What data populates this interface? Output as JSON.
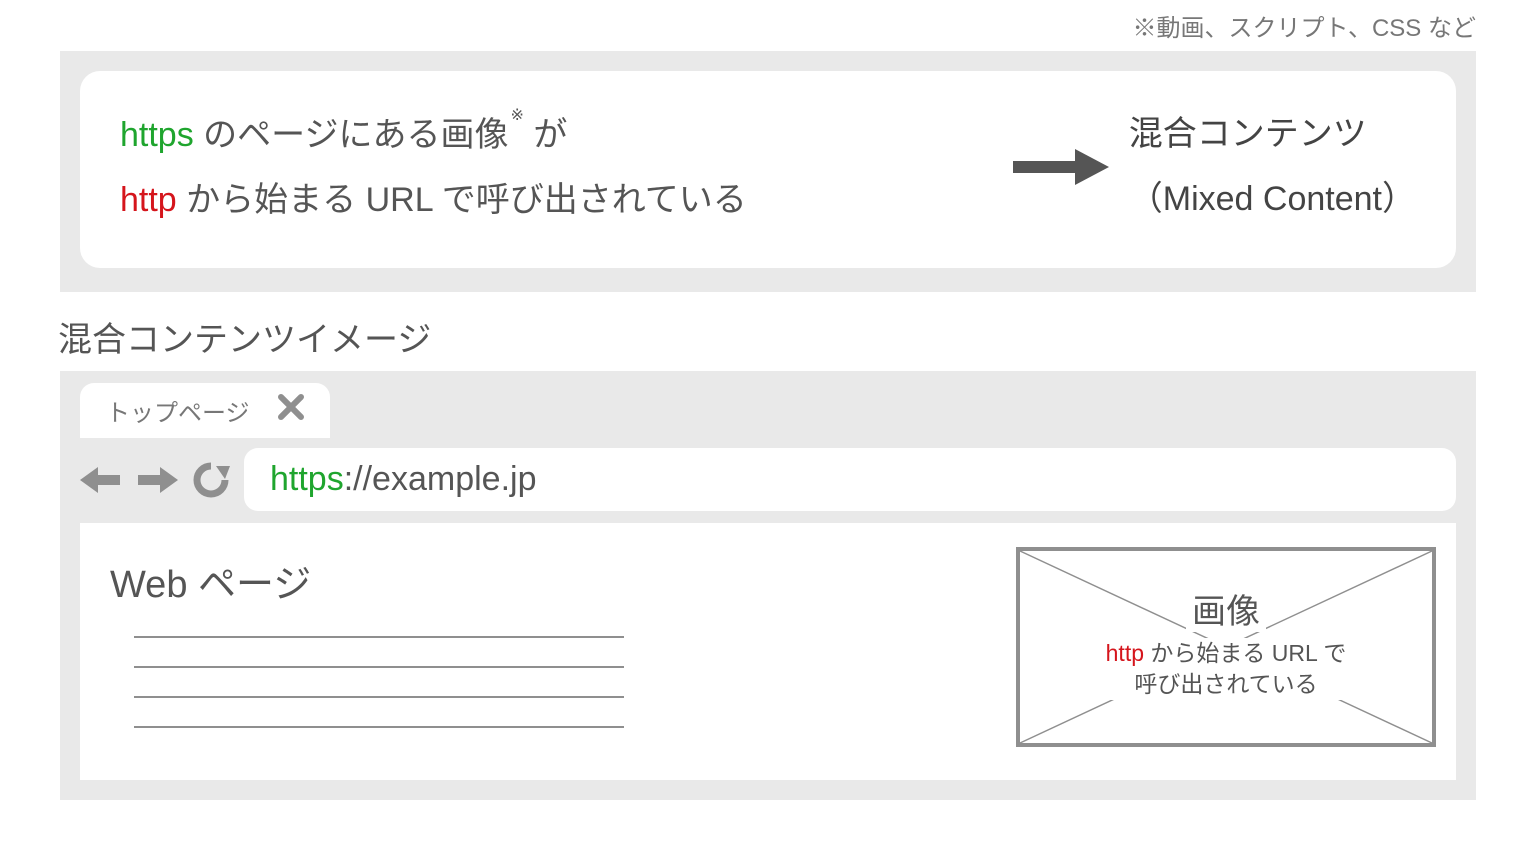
{
  "top_note": "※動画、スクリプト、CSS など",
  "card": {
    "https": "https",
    "line1_rest": " のページにある画像",
    "asterisk": "※",
    "line1_tail": " が",
    "http": "http",
    "line2_rest": " から始まる URL で呼び出されている",
    "result_line1": "混合コンテンツ",
    "result_line2": "（Mixed Content）"
  },
  "section_title": "混合コンテンツイメージ",
  "browser": {
    "tab_label": "トップページ",
    "url_scheme": "https",
    "url_rest": "://example.jp",
    "page_title": "Web ページ",
    "imgbox_label": "画像",
    "imgbox_sub_http": "http",
    "imgbox_sub_l1_rest": " から始まる URL で",
    "imgbox_sub_l2": "呼び出されている"
  },
  "colors": {
    "green": "#1fa52e",
    "red": "#d5151c",
    "grey_bg": "#e9e9e9",
    "grey_stroke": "#8f8f8f"
  }
}
